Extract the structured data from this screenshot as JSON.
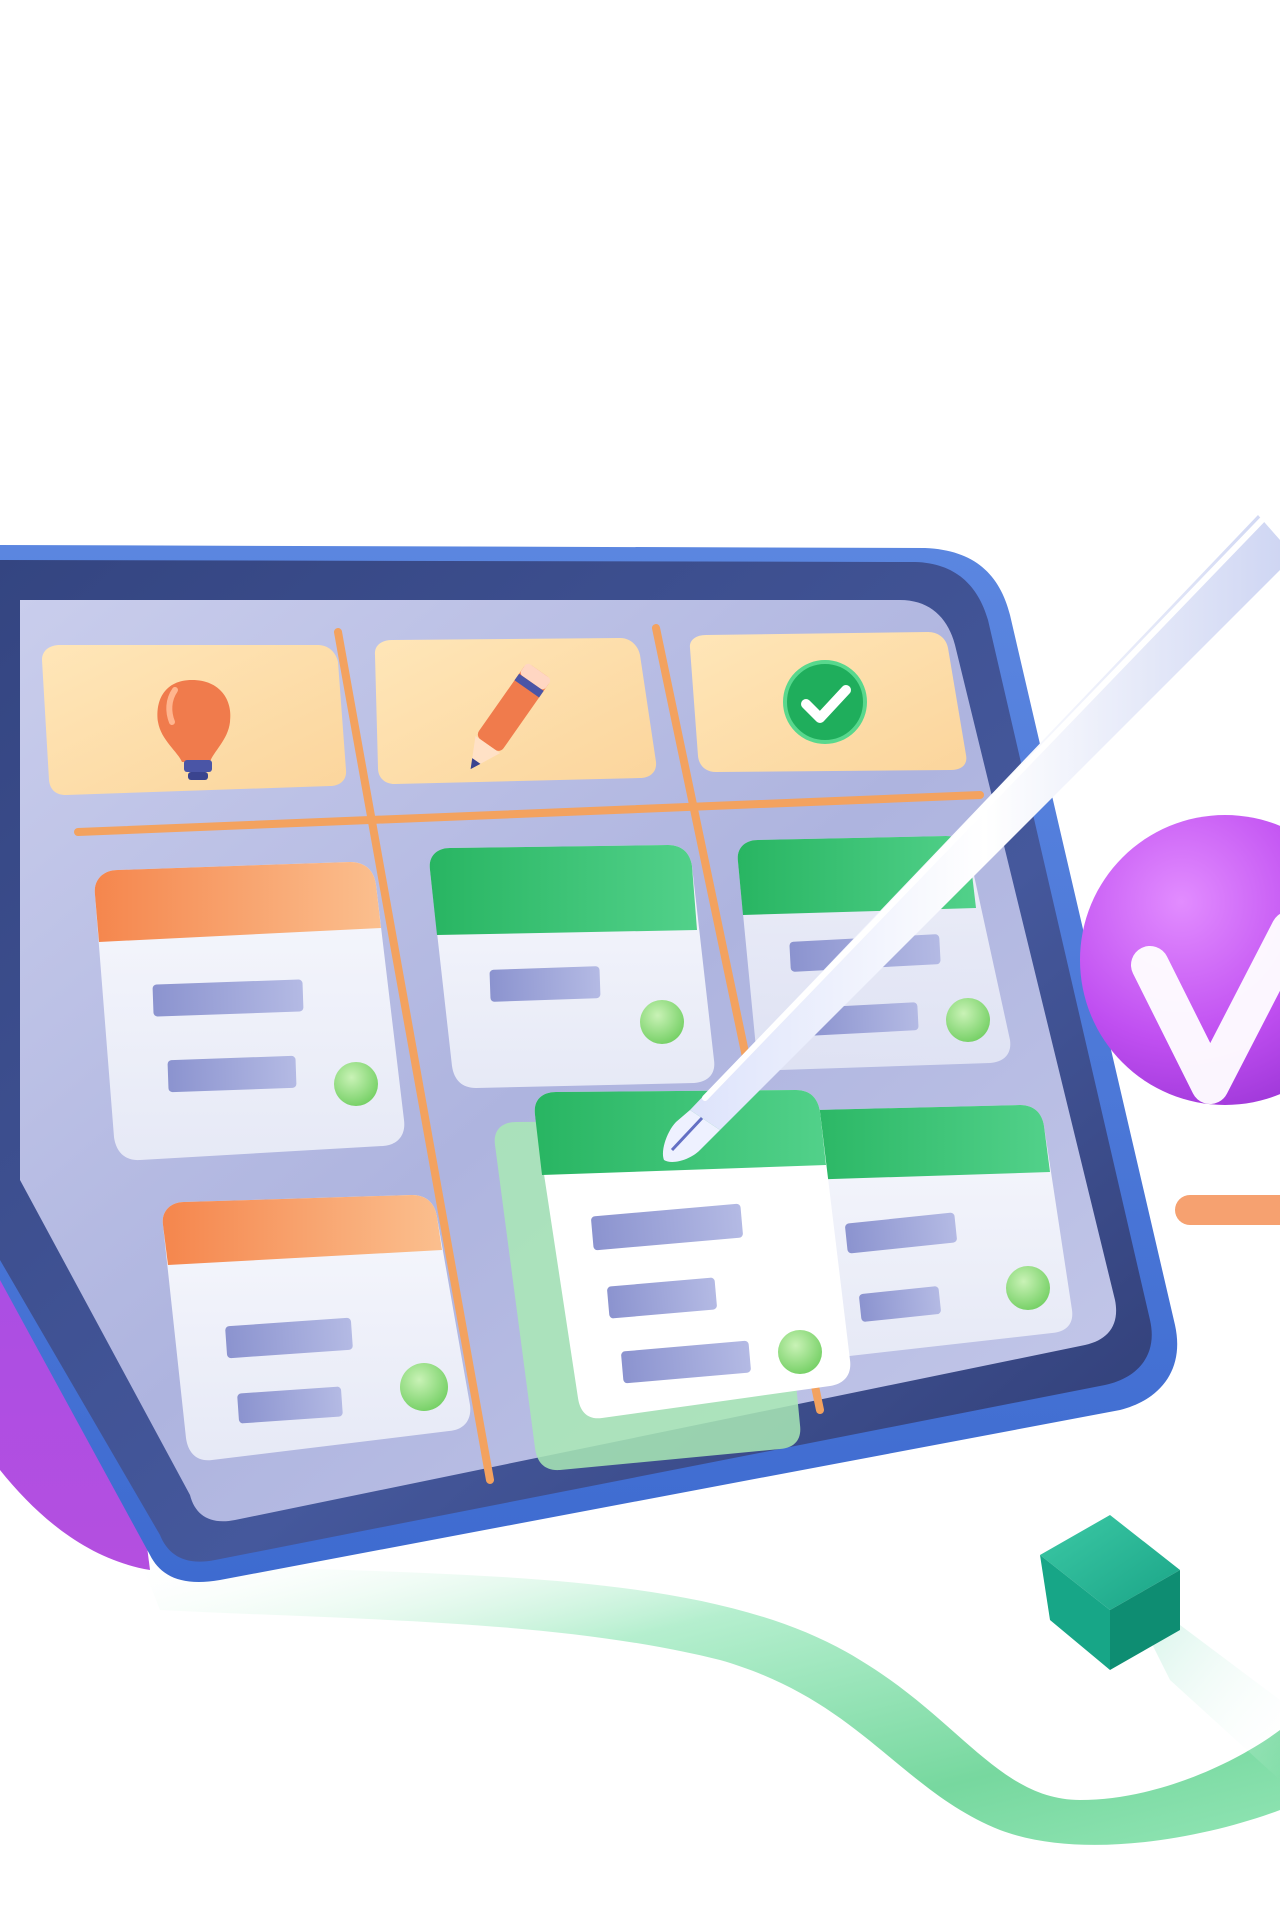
{
  "illustration": {
    "kind": "kanban-tablet-illustration",
    "columns": [
      {
        "icon": "lightbulb-icon",
        "accent": "#f08552",
        "cards": 2
      },
      {
        "icon": "pencil-icon",
        "accent": "#2fbf6b",
        "cards": 2
      },
      {
        "icon": "check-circle-icon",
        "accent": "#2fbf6b",
        "cards": 2
      }
    ],
    "colors": {
      "tablet_frame": "#3f4f8e",
      "tablet_edge": "#5a7fd8",
      "screen": "#b3b9e1",
      "column_header": "#fddfa9",
      "divider": "#f3a25f",
      "card_orange_header": "#f59a62",
      "card_green_header": "#2fbf6b",
      "card_bar": "#9aa2d6",
      "card_dot": "#8fdc7a",
      "side_badge": "#c152f0",
      "stylus": "#f4f6ff",
      "ribbon_green": "#6dd59a",
      "cube": "#20b592"
    }
  }
}
